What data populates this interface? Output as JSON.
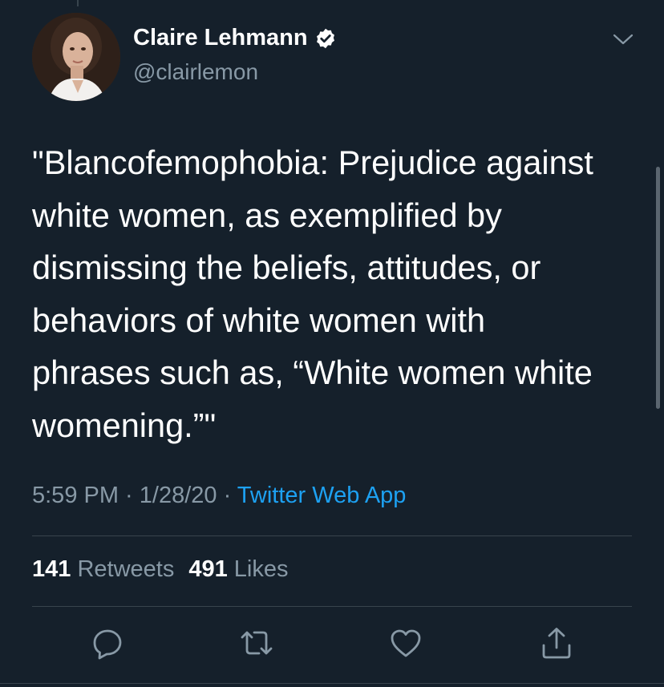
{
  "tweet": {
    "author": {
      "display_name": "Claire Lehmann",
      "handle": "@clairlemon",
      "verified_icon": "verified-badge-icon",
      "avatar": "profile photo"
    },
    "text_lines": [
      "\"Blancofemophobia: Prejudice against",
      "white women, as exemplified by",
      "dismissing the beliefs, attitudes, or",
      "behaviors of white women with",
      "phrases such as, “White women white",
      "womening.”\""
    ],
    "time": "5:59 PM",
    "separator": " · ",
    "date": "1/28/20",
    "source": "Twitter Web App",
    "retweets": {
      "count": "141",
      "label": "Retweets"
    },
    "likes": {
      "count": "491",
      "label": "Likes"
    }
  },
  "actions": [
    "reply-icon",
    "retweet-icon",
    "like-icon",
    "share-icon"
  ],
  "colors": {
    "background": "#15202b",
    "text": "#ffffff",
    "secondary": "#8899a6",
    "accent": "#1da1f2",
    "divider": "#38444d"
  }
}
